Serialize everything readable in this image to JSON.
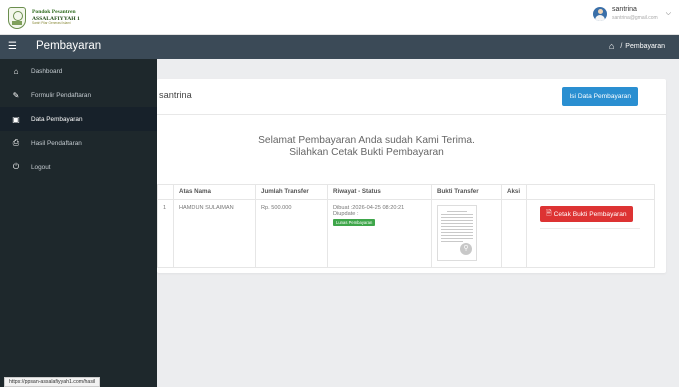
{
  "header": {
    "logo_line1": "Pondok Pesantren",
    "logo_line2": "ASSALAFIYYAH 1",
    "logo_line3": "Santri Pilar Generasi Islami",
    "user_name": "santrina",
    "user_email": "santrina@gmail.com"
  },
  "navbar": {
    "title": "Pembayaran",
    "breadcrumb_home_icon": "home-icon",
    "breadcrumb_sep": "/",
    "breadcrumb_current": "Pembayaran"
  },
  "sidebar": {
    "items": [
      {
        "label": "Dashboard",
        "icon": "dashboard-icon"
      },
      {
        "label": "Formulir Pendaftaran",
        "icon": "edit-icon"
      },
      {
        "label": "Data Pembayaran",
        "icon": "money-icon"
      },
      {
        "label": "Hasil Pendaftaran",
        "icon": "print-icon"
      },
      {
        "label": "Logout",
        "icon": "power-icon"
      }
    ]
  },
  "status_bar": {
    "url": "https://ppsan-assalafiyyah1.com/hasil"
  },
  "card": {
    "user_label": "santrina",
    "isi_button": "Isi Data Pembayaran",
    "message_line1": "Selamat Pembayaran Anda sudah Kami Terima.",
    "message_line2": "Silahkan Cetak Bukti Pembayaran"
  },
  "table": {
    "headers": [
      "Atas Nama",
      "Jumlah Transfer",
      "Riwayat - Status",
      "Bukti Transfer",
      "Aksi"
    ],
    "rows": [
      {
        "row_no": "1",
        "atas_nama": "HAMDUN SULAIMAN",
        "jumlah": "Rp. 500.000",
        "dibuat": "Dibuat :2026-04-25 08:20:21",
        "diupdate": "Diupdate :",
        "status": "Lunas Pembayaran",
        "cetak_button": "Cetak Bukti Pembayaran"
      }
    ]
  },
  "colors": {
    "sidebar_bg": "#1e282c",
    "navbar_bg": "#3b4a57",
    "primary": "#2a8fd1",
    "danger": "#dd3333",
    "success": "#3ea64a"
  }
}
